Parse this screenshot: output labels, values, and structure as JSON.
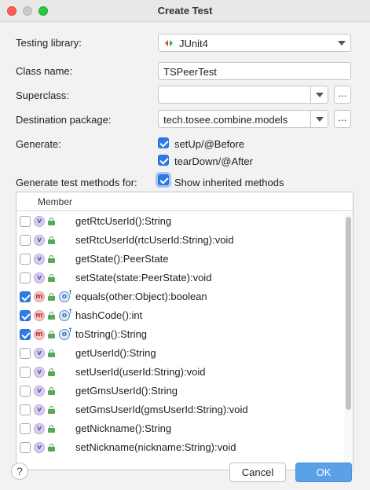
{
  "window": {
    "title": "Create Test"
  },
  "form": {
    "testing_library_label": "Testing library:",
    "testing_library_value": "JUnit4",
    "class_name_label": "Class name:",
    "class_name_value": "TSPeerTest",
    "superclass_label": "Superclass:",
    "superclass_value": "",
    "superclass_more": "...",
    "destination_label": "Destination package:",
    "destination_value": "tech.tosee.combine.models",
    "destination_more": "...",
    "generate_label": "Generate:",
    "setup_label": "setUp/@Before",
    "setup_checked": true,
    "teardown_label": "tearDown/@After",
    "teardown_checked": true,
    "methods_for_label": "Generate test methods for:",
    "show_inherited_label": "Show inherited methods",
    "show_inherited_checked": true
  },
  "table": {
    "column_header": "Member",
    "rows": [
      {
        "kind": "v",
        "checked": false,
        "override": false,
        "name": "getRtcUserId():String"
      },
      {
        "kind": "v",
        "checked": false,
        "override": false,
        "name": "setRtcUserId(rtcUserId:String):void"
      },
      {
        "kind": "v",
        "checked": false,
        "override": false,
        "name": "getState():PeerState"
      },
      {
        "kind": "v",
        "checked": false,
        "override": false,
        "name": "setState(state:PeerState):void"
      },
      {
        "kind": "m",
        "checked": true,
        "override": true,
        "name": "equals(other:Object):boolean"
      },
      {
        "kind": "m",
        "checked": true,
        "override": true,
        "name": "hashCode():int"
      },
      {
        "kind": "m",
        "checked": true,
        "override": true,
        "name": "toString():String"
      },
      {
        "kind": "v",
        "checked": false,
        "override": false,
        "name": "getUserId():String"
      },
      {
        "kind": "v",
        "checked": false,
        "override": false,
        "name": "setUserId(userId:String):void"
      },
      {
        "kind": "v",
        "checked": false,
        "override": false,
        "name": "getGmsUserId():String"
      },
      {
        "kind": "v",
        "checked": false,
        "override": false,
        "name": "setGmsUserId(gmsUserId:String):void"
      },
      {
        "kind": "v",
        "checked": false,
        "override": false,
        "name": "getNickname():String"
      },
      {
        "kind": "v",
        "checked": false,
        "override": false,
        "name": "setNickname(nickname:String):void"
      }
    ]
  },
  "footer": {
    "help_label": "?",
    "cancel_label": "Cancel",
    "ok_label": "OK"
  },
  "colors": {
    "accent": "#2e7ae6",
    "ok_button": "#5ba1e8",
    "visibility_badge": "#d8ccef",
    "method_badge": "#f4c6c6",
    "lock_green": "#5ba85b"
  }
}
